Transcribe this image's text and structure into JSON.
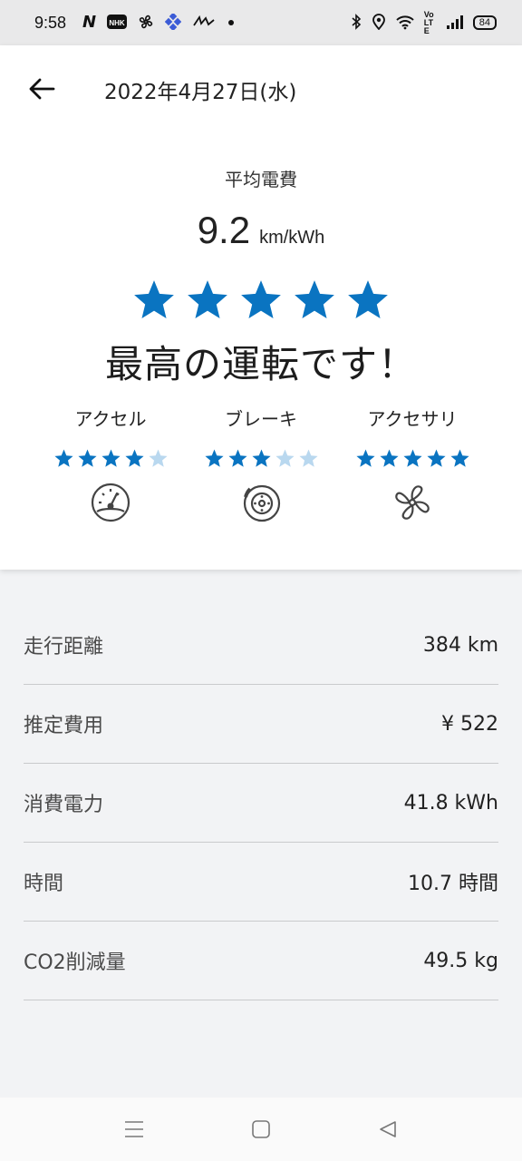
{
  "status_bar": {
    "time": "9:58",
    "left_icons": [
      "n-logo-icon",
      "nhk-icon",
      "fan-notification-icon",
      "grid-app-icon",
      "app-logo-icon",
      "dot-icon"
    ],
    "right_icons": [
      "bluetooth-icon",
      "location-icon",
      "wifi-icon",
      "volte-icon",
      "signal-icon"
    ],
    "volte_text": "VoLTE",
    "battery": "84"
  },
  "header": {
    "date": "2022年4月27日(水)"
  },
  "summary": {
    "avg_label": "平均電費",
    "avg_value": "9.2",
    "avg_unit": "km/kWh",
    "overall_rating": 5,
    "message": "最高の運転です！"
  },
  "metrics": [
    {
      "label": "アクセル",
      "rating": 4,
      "icon": "speedometer-icon"
    },
    {
      "label": "ブレーキ",
      "rating": 3,
      "icon": "brake-disc-icon"
    },
    {
      "label": "アクセサリ",
      "rating": 5,
      "icon": "fan-icon"
    }
  ],
  "stats": [
    {
      "label": "走行距離",
      "value": "384 km"
    },
    {
      "label": "推定費用",
      "value": "¥ 522"
    },
    {
      "label": "消費電力",
      "value": "41.8 kWh"
    },
    {
      "label": "時間",
      "value": "10.7 時間"
    },
    {
      "label": "CO2削減量",
      "value": "49.5 kg"
    }
  ],
  "colors": {
    "star_filled": "#0a74c1",
    "star_empty": "#b9d8ef",
    "card_bg": "#ffffff",
    "page_bg": "#f2f3f5"
  },
  "nav_buttons": [
    "menu-icon",
    "home-icon",
    "back-triangle-icon"
  ]
}
